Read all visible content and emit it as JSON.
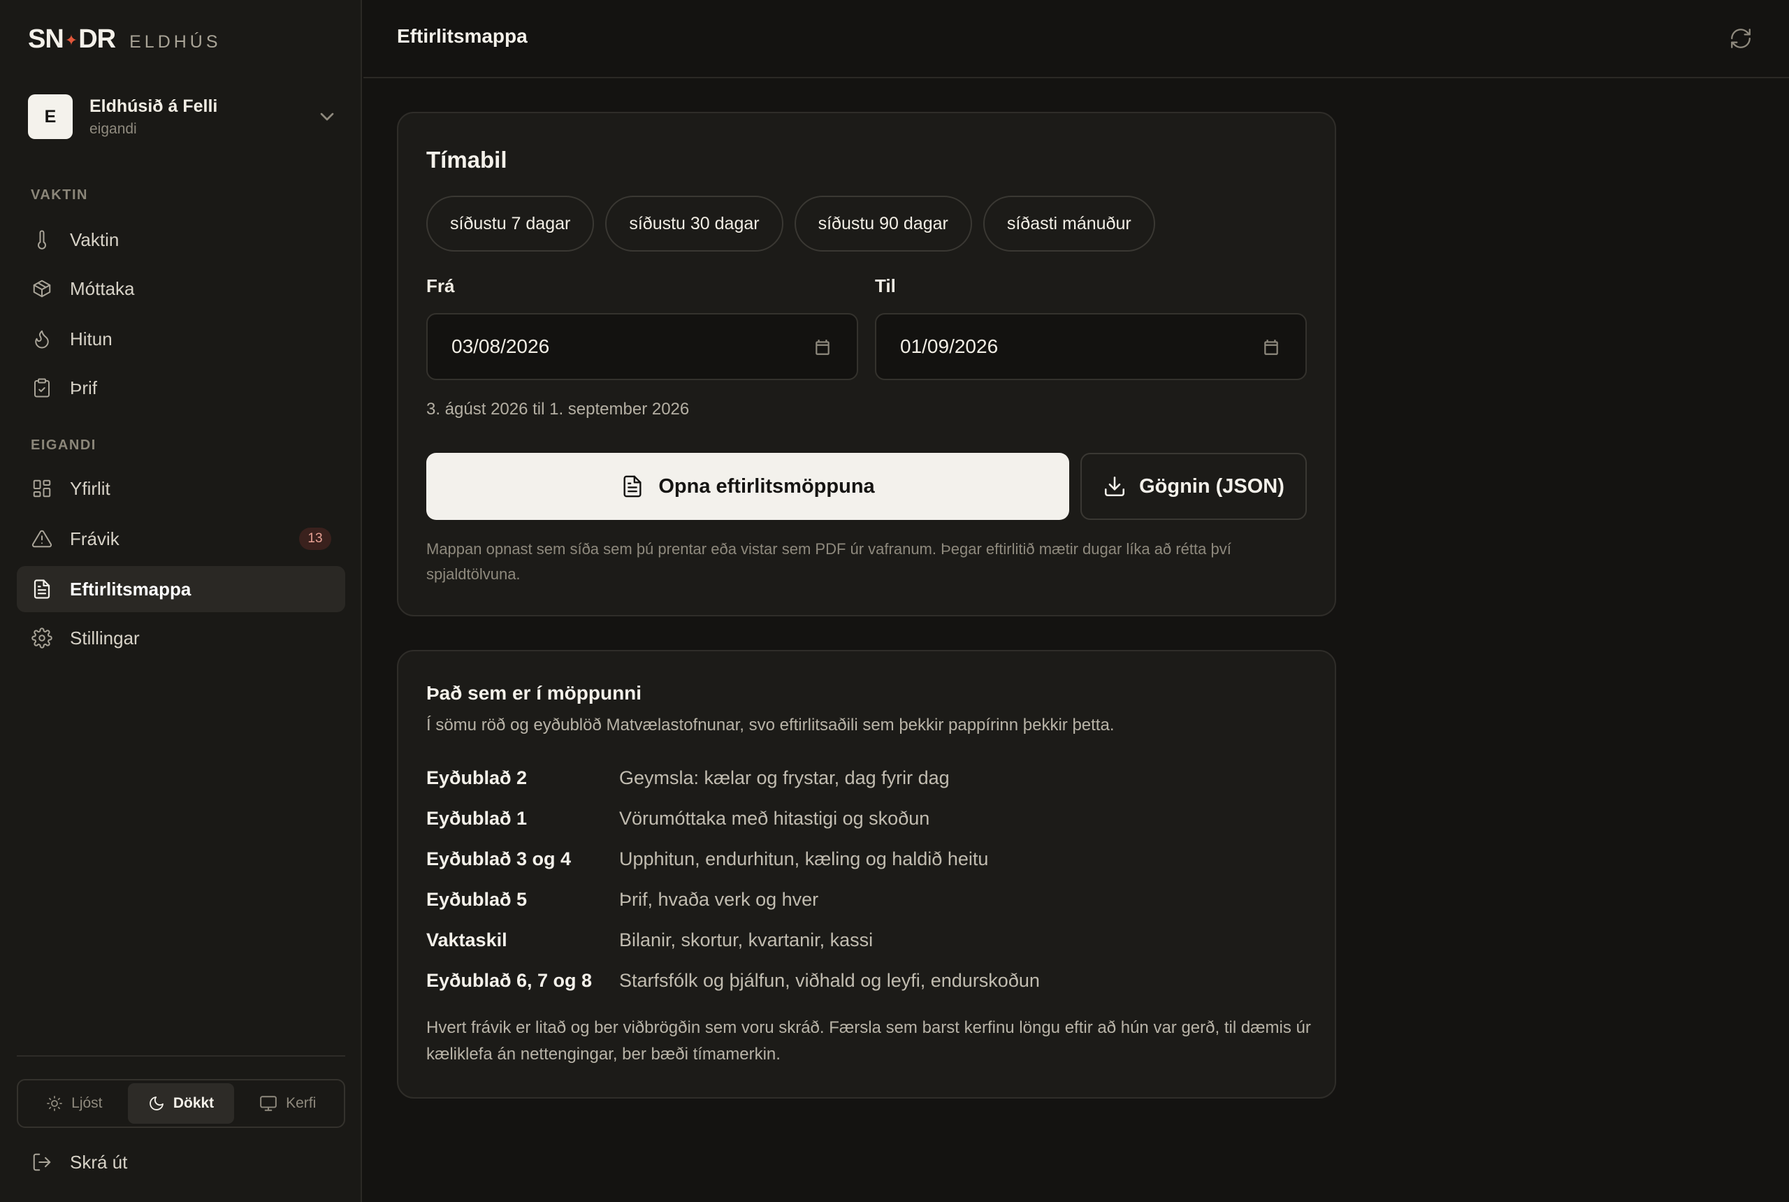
{
  "brand": {
    "mark_left": "SN",
    "mark_right": "DR",
    "sub": "ELDHÚS"
  },
  "workspace": {
    "initial": "E",
    "name": "Eldhúsið á Felli",
    "role": "eigandi"
  },
  "sections": {
    "shift": "VAKTIN",
    "owner": "EIGANDI"
  },
  "nav": {
    "vaktin": "Vaktin",
    "mottaka": "Móttaka",
    "hitun": "Hitun",
    "thrif": "Þrif",
    "yfirlit": "Yfirlit",
    "fravik": "Frávik",
    "fravik_count": "13",
    "eftirlitsmappa": "Eftirlitsmappa",
    "stillingar": "Stillingar"
  },
  "theme": {
    "light": "Ljóst",
    "dark": "Dökkt",
    "system": "Kerfi",
    "selected": "Dökkt"
  },
  "logout": "Skrá út",
  "header": {
    "title": "Eftirlitsmappa"
  },
  "period": {
    "title": "Tímabil",
    "presets": [
      "síðustu 7 dagar",
      "síðustu 30 dagar",
      "síðustu 90 dagar",
      "síðasti mánuður"
    ],
    "from_label": "Frá",
    "to_label": "Til",
    "from_value": "03/08/2026",
    "to_value": "01/09/2026",
    "range_text": "3. ágúst 2026 til 1. september 2026",
    "open_button": "Opna eftirlitsmöppuna",
    "json_button": "Gögnin (JSON)",
    "help": "Mappan opnast sem síða sem þú prentar eða vistar sem PDF úr vafranum. Þegar eftirlitið mætir dugar líka að rétta því spjaldtölvuna."
  },
  "contents": {
    "title": "Það sem er í möppunni",
    "subtitle": "Í sömu röð og eyðublöð Matvælastofnunar, svo eftirlitsaðili sem þekkir pappírinn þekkir þetta.",
    "rows": [
      {
        "name": "Eyðublað 2",
        "desc": "Geymsla: kælar og frystar, dag fyrir dag"
      },
      {
        "name": "Eyðublað 1",
        "desc": "Vörumóttaka með hitastigi og skoðun"
      },
      {
        "name": "Eyðublað 3 og 4",
        "desc": "Upphitun, endurhitun, kæling og haldið heitu"
      },
      {
        "name": "Eyðublað 5",
        "desc": "Þrif, hvaða verk og hver"
      },
      {
        "name": "Vaktaskil",
        "desc": "Bilanir, skortur, kvartanir, kassi"
      },
      {
        "name": "Eyðublað 6, 7 og 8",
        "desc": "Starfsfólk og þjálfun, viðhald og leyfi, endurskoðun"
      }
    ],
    "footnote": "Hvert frávik er litað og ber viðbrögðin sem voru skráð. Færsla sem barst kerfinu löngu eftir að hún var gerð, til dæmis úr kæliklefa án nettengingar, ber bæði tímamerkin."
  },
  "colors": {
    "accent": "#e2573a",
    "background": "#141311",
    "sidebar": "#1a1916",
    "card": "#1c1b18",
    "badge": "#3a211d"
  },
  "icons": {
    "vaktin": "thermometer-icon",
    "mottaka": "package-icon",
    "hitun": "flame-icon",
    "thrif": "clipboard-check-icon",
    "yfirlit": "grid-icon",
    "fravik": "warning-icon",
    "eftirlitsmappa": "document-icon",
    "stillingar": "gear-icon",
    "refresh": "refresh-icon",
    "logout": "logout-icon",
    "download": "download-icon",
    "calendar": "calendar-icon"
  }
}
